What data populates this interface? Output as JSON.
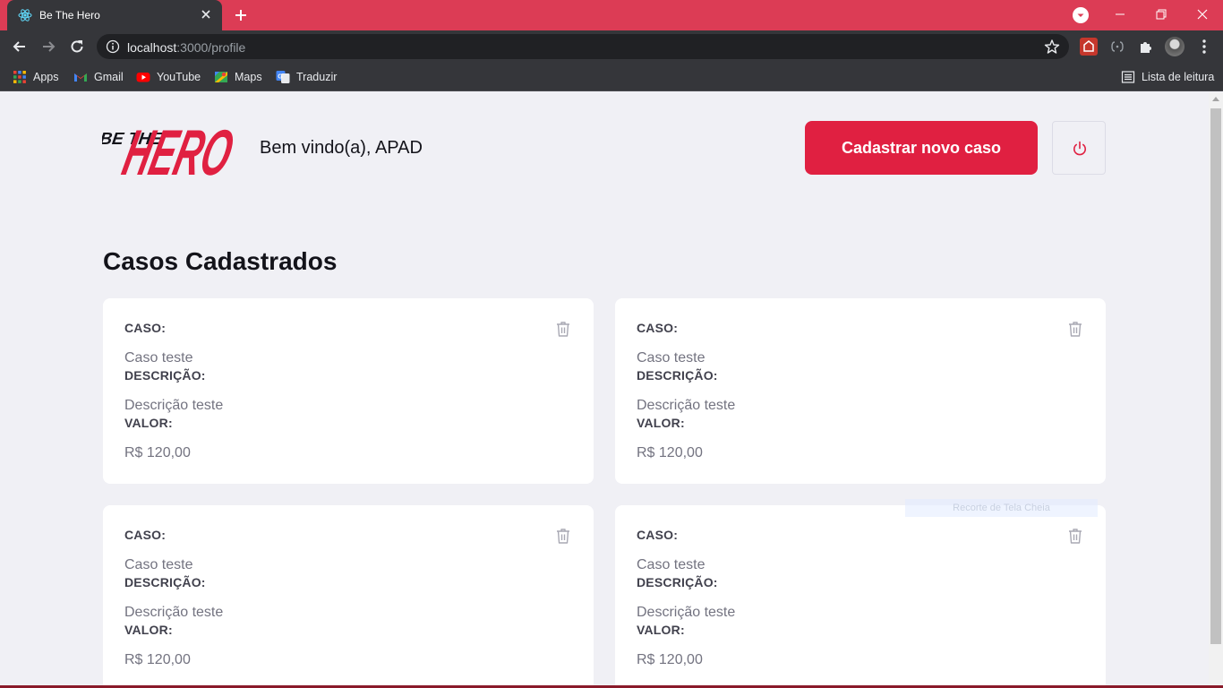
{
  "browser": {
    "tab_title": "Be The Hero",
    "url_host": "localhost",
    "url_path": ":3000/profile",
    "bookmarks": [
      {
        "label": "Apps",
        "icon": "apps-grid-icon"
      },
      {
        "label": "Gmail",
        "icon": "gmail-icon"
      },
      {
        "label": "YouTube",
        "icon": "youtube-icon"
      },
      {
        "label": "Maps",
        "icon": "maps-icon"
      },
      {
        "label": "Traduzir",
        "icon": "translate-icon"
      }
    ],
    "reading_list": "Lista de leitura",
    "colors": {
      "titlebar": "#dc3c55",
      "toolbar": "#35363a"
    }
  },
  "header": {
    "logo_small": "BE THE",
    "logo_big": "HERO",
    "welcome": "Bem vindo(a), APAD",
    "new_case_button": "Cadastrar novo caso",
    "logout_icon": "power-icon"
  },
  "main": {
    "title": "Casos Cadastrados",
    "labels": {
      "case": "CASO:",
      "description": "DESCRIÇÃO:",
      "value": "VALOR:"
    },
    "cases": [
      {
        "case": "Caso teste",
        "description": "Descrição teste",
        "value": "R$ 120,00"
      },
      {
        "case": "Caso teste",
        "description": "Descrição teste",
        "value": "R$ 120,00"
      },
      {
        "case": "Caso teste",
        "description": "Descrição teste",
        "value": "R$ 120,00"
      },
      {
        "case": "Caso teste",
        "description": "Descrição teste",
        "value": "R$ 120,00"
      }
    ]
  },
  "overlay": {
    "snip_hint": "Recorte de Tela Cheia"
  },
  "colors": {
    "accent": "#e02041",
    "background": "#f0f0f5",
    "card": "#ffffff",
    "label": "#41414d",
    "value": "#737380"
  }
}
